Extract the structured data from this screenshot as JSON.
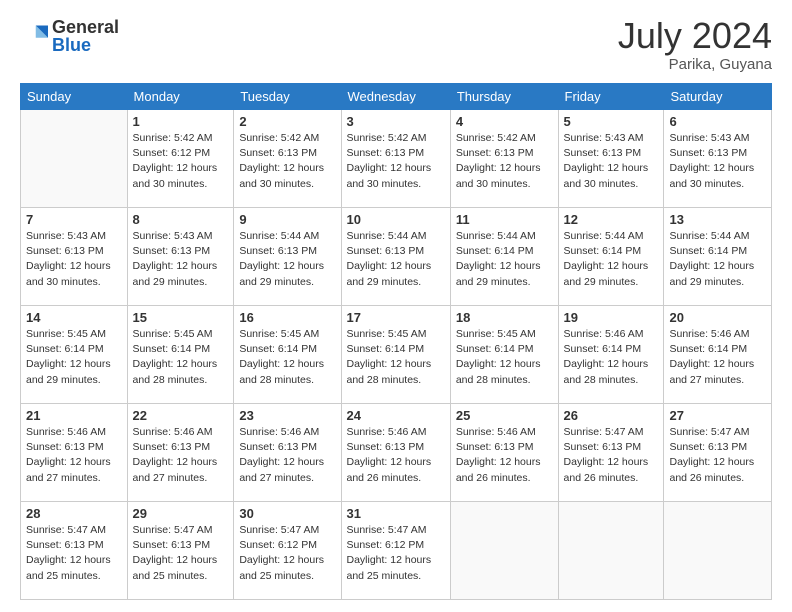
{
  "header": {
    "logo_general": "General",
    "logo_blue": "Blue",
    "title": "July 2024",
    "location": "Parika, Guyana"
  },
  "days_of_week": [
    "Sunday",
    "Monday",
    "Tuesday",
    "Wednesday",
    "Thursday",
    "Friday",
    "Saturday"
  ],
  "weeks": [
    [
      {
        "day": "",
        "info": ""
      },
      {
        "day": "1",
        "info": "Sunrise: 5:42 AM\nSunset: 6:12 PM\nDaylight: 12 hours\nand 30 minutes."
      },
      {
        "day": "2",
        "info": "Sunrise: 5:42 AM\nSunset: 6:13 PM\nDaylight: 12 hours\nand 30 minutes."
      },
      {
        "day": "3",
        "info": "Sunrise: 5:42 AM\nSunset: 6:13 PM\nDaylight: 12 hours\nand 30 minutes."
      },
      {
        "day": "4",
        "info": "Sunrise: 5:42 AM\nSunset: 6:13 PM\nDaylight: 12 hours\nand 30 minutes."
      },
      {
        "day": "5",
        "info": "Sunrise: 5:43 AM\nSunset: 6:13 PM\nDaylight: 12 hours\nand 30 minutes."
      },
      {
        "day": "6",
        "info": "Sunrise: 5:43 AM\nSunset: 6:13 PM\nDaylight: 12 hours\nand 30 minutes."
      }
    ],
    [
      {
        "day": "7",
        "info": ""
      },
      {
        "day": "8",
        "info": "Sunrise: 5:43 AM\nSunset: 6:13 PM\nDaylight: 12 hours\nand 29 minutes."
      },
      {
        "day": "9",
        "info": "Sunrise: 5:44 AM\nSunset: 6:13 PM\nDaylight: 12 hours\nand 29 minutes."
      },
      {
        "day": "10",
        "info": "Sunrise: 5:44 AM\nSunset: 6:13 PM\nDaylight: 12 hours\nand 29 minutes."
      },
      {
        "day": "11",
        "info": "Sunrise: 5:44 AM\nSunset: 6:14 PM\nDaylight: 12 hours\nand 29 minutes."
      },
      {
        "day": "12",
        "info": "Sunrise: 5:44 AM\nSunset: 6:14 PM\nDaylight: 12 hours\nand 29 minutes."
      },
      {
        "day": "13",
        "info": "Sunrise: 5:44 AM\nSunset: 6:14 PM\nDaylight: 12 hours\nand 29 minutes."
      }
    ],
    [
      {
        "day": "14",
        "info": ""
      },
      {
        "day": "15",
        "info": "Sunrise: 5:45 AM\nSunset: 6:14 PM\nDaylight: 12 hours\nand 28 minutes."
      },
      {
        "day": "16",
        "info": "Sunrise: 5:45 AM\nSunset: 6:14 PM\nDaylight: 12 hours\nand 28 minutes."
      },
      {
        "day": "17",
        "info": "Sunrise: 5:45 AM\nSunset: 6:14 PM\nDaylight: 12 hours\nand 28 minutes."
      },
      {
        "day": "18",
        "info": "Sunrise: 5:45 AM\nSunset: 6:14 PM\nDaylight: 12 hours\nand 28 minutes."
      },
      {
        "day": "19",
        "info": "Sunrise: 5:46 AM\nSunset: 6:14 PM\nDaylight: 12 hours\nand 28 minutes."
      },
      {
        "day": "20",
        "info": "Sunrise: 5:46 AM\nSunset: 6:14 PM\nDaylight: 12 hours\nand 27 minutes."
      }
    ],
    [
      {
        "day": "21",
        "info": ""
      },
      {
        "day": "22",
        "info": "Sunrise: 5:46 AM\nSunset: 6:13 PM\nDaylight: 12 hours\nand 27 minutes."
      },
      {
        "day": "23",
        "info": "Sunrise: 5:46 AM\nSunset: 6:13 PM\nDaylight: 12 hours\nand 27 minutes."
      },
      {
        "day": "24",
        "info": "Sunrise: 5:46 AM\nSunset: 6:13 PM\nDaylight: 12 hours\nand 26 minutes."
      },
      {
        "day": "25",
        "info": "Sunrise: 5:46 AM\nSunset: 6:13 PM\nDaylight: 12 hours\nand 26 minutes."
      },
      {
        "day": "26",
        "info": "Sunrise: 5:47 AM\nSunset: 6:13 PM\nDaylight: 12 hours\nand 26 minutes."
      },
      {
        "day": "27",
        "info": "Sunrise: 5:47 AM\nSunset: 6:13 PM\nDaylight: 12 hours\nand 26 minutes."
      }
    ],
    [
      {
        "day": "28",
        "info": "Sunrise: 5:47 AM\nSunset: 6:13 PM\nDaylight: 12 hours\nand 25 minutes."
      },
      {
        "day": "29",
        "info": "Sunrise: 5:47 AM\nSunset: 6:13 PM\nDaylight: 12 hours\nand 25 minutes."
      },
      {
        "day": "30",
        "info": "Sunrise: 5:47 AM\nSunset: 6:12 PM\nDaylight: 12 hours\nand 25 minutes."
      },
      {
        "day": "31",
        "info": "Sunrise: 5:47 AM\nSunset: 6:12 PM\nDaylight: 12 hours\nand 25 minutes."
      },
      {
        "day": "",
        "info": ""
      },
      {
        "day": "",
        "info": ""
      },
      {
        "day": "",
        "info": ""
      }
    ]
  ],
  "week_day_info_row1_sun": "",
  "week_day_info_row2_sun": "Sunrise: 5:43 AM\nSunset: 6:13 PM\nDaylight: 12 hours\nand 30 minutes.",
  "week_day_info_row3_sun": "Sunrise: 5:45 AM\nSunset: 6:14 PM\nDaylight: 12 hours\nand 29 minutes.",
  "week_day_info_row4_sun": "Sunrise: 5:46 AM\nSunset: 6:13 PM\nDaylight: 12 hours\nand 27 minutes."
}
